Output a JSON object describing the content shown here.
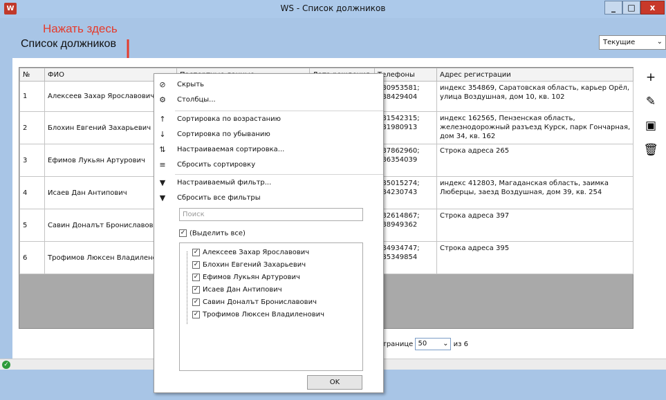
{
  "window": {
    "app_icon": "W",
    "title": "WS - Список должников",
    "buttons": {
      "minimize": "_",
      "maximize": "□",
      "close": "x"
    }
  },
  "annotation": "Нажать здесь",
  "header": {
    "page_title": "Список должников",
    "filter_value": "Текущие"
  },
  "table": {
    "columns": [
      "№",
      "ФИО",
      "Паспортные данные",
      "Дата рождения",
      "Телефоны",
      "Адрес регистрации"
    ],
    "rows": [
      {
        "num": "1",
        "fio": "Алексеев Захар Ярославович",
        "phones": "080953581;\n088429404",
        "address": "индекс 354869, Саратовская область, карьер Орёл, улица Воздушная, дом 10, кв. 102"
      },
      {
        "num": "2",
        "fio": "Блохин Евгений Захарьевич",
        "phones": "081542315;\n081980913",
        "address": "индекс 162565, Пензенская область, железнодорожный разъезд Курск, парк Гончарная, дом 34, кв. 162"
      },
      {
        "num": "3",
        "fio": "Ефимов Лукьян Артурович",
        "phones": "087862960;\n086354039",
        "address": "Строка адреса 265"
      },
      {
        "num": "4",
        "fio": "Исаев Дан Антипович",
        "phones": "085015274;\n084230743",
        "address": "индекс 412803, Магаданская область, заимка Люберцы, заезд Воздушная, дом 39, кв. 254"
      },
      {
        "num": "5",
        "fio": "Савин Доналът Брониславови",
        "phones": "082614867;\n088949362",
        "address": "Строка адреса 397"
      },
      {
        "num": "6",
        "fio": "Трофимов Люксен Владилено",
        "phones": "084934747;\n085349854",
        "address": "Строка адреса 395"
      }
    ]
  },
  "side_buttons": [
    {
      "icon": "plus-icon",
      "glyph": "+"
    },
    {
      "icon": "pencil-icon",
      "glyph": "✎"
    },
    {
      "icon": "archive-icon",
      "glyph": "▣"
    },
    {
      "icon": "trash-icon",
      "glyph": "🗑"
    }
  ],
  "paging": {
    "prefix": "транице",
    "per_page": "50",
    "suffix": "из 6"
  },
  "context_menu": {
    "items": [
      {
        "icon": "hide-eye-icon",
        "label": "Скрыть"
      },
      {
        "icon": "gear-icon",
        "label": "Столбцы..."
      },
      {
        "icon": "sort-asc-icon",
        "label": "Сортировка по возрастанию"
      },
      {
        "icon": "sort-desc-icon",
        "label": "Сортировка по убыванию"
      },
      {
        "icon": "custom-sort-icon",
        "label": "Настраиваемая сортировка..."
      },
      {
        "icon": "clear-sort-icon",
        "label": "Сбросить сортировку"
      },
      {
        "icon": "filter-icon",
        "label": "Настраиваемый фильтр..."
      },
      {
        "icon": "clear-filter-icon",
        "label": "Сбросить все фильтры"
      }
    ],
    "search_placeholder": "Поиск",
    "select_all": "(Выделить все)",
    "values": [
      "Алексеев Захар Ярославович",
      "Блохин Евгений Захарьевич",
      "Ефимов Лукьян Артурович",
      "Исаев Дан Антипович",
      "Савин Доналът Брониславович",
      "Трофимов Люксен Владиленович"
    ],
    "ok_label": "OK"
  },
  "colors": {
    "chrome": "#a8c5e6",
    "annotation": "#e53b2c",
    "close": "#c8392a",
    "status_ok": "#2e9a3b"
  }
}
